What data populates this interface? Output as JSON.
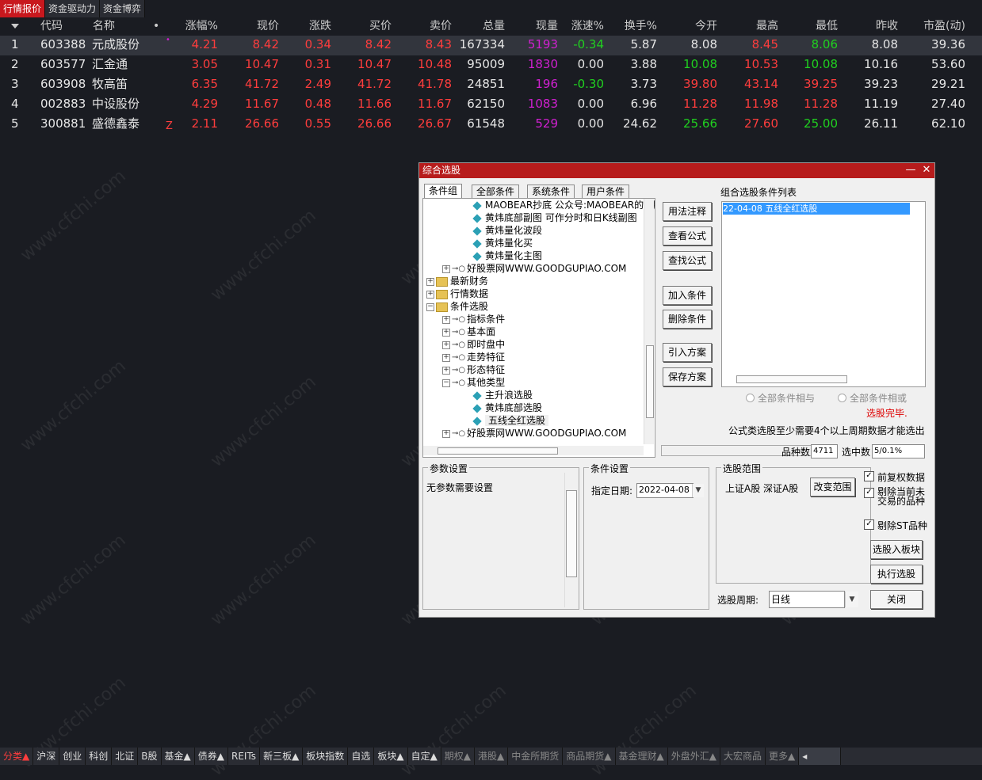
{
  "top_tabs": [
    "行情报价",
    "资金驱动力",
    "资金博弈"
  ],
  "columns": [
    "代码",
    "名称",
    "•",
    "涨幅%",
    "现价",
    "涨跌",
    "买价",
    "卖价",
    "总量",
    "现量",
    "涨速%",
    "换手%",
    "今开",
    "最高",
    "最低",
    "昨收",
    "市盈(动)"
  ],
  "rows": [
    {
      "idx": "1",
      "code": "603388",
      "name": "元成股份",
      "flag": "•",
      "chg_pct": "4.21",
      "price": "8.42",
      "chg": "0.34",
      "bid": "8.42",
      "ask": "8.43",
      "vol": "167334",
      "cur_vol": "5193",
      "speed": "-0.34",
      "turnover": "5.87",
      "open": "8.08",
      "high": "8.45",
      "low": "8.06",
      "prev": "8.08",
      "pe": "39.36"
    },
    {
      "idx": "2",
      "code": "603577",
      "name": "汇金通",
      "flag": "",
      "chg_pct": "3.05",
      "price": "10.47",
      "chg": "0.31",
      "bid": "10.47",
      "ask": "10.48",
      "vol": "95009",
      "cur_vol": "1830",
      "speed": "0.00",
      "turnover": "3.88",
      "open": "10.08",
      "high": "10.53",
      "low": "10.08",
      "prev": "10.16",
      "pe": "53.60"
    },
    {
      "idx": "3",
      "code": "603908",
      "name": "牧高笛",
      "flag": "",
      "chg_pct": "6.35",
      "price": "41.72",
      "chg": "2.49",
      "bid": "41.72",
      "ask": "41.78",
      "vol": "24851",
      "cur_vol": "196",
      "speed": "-0.30",
      "turnover": "3.73",
      "open": "39.80",
      "high": "43.14",
      "low": "39.25",
      "prev": "39.23",
      "pe": "29.21"
    },
    {
      "idx": "4",
      "code": "002883",
      "name": "中设股份",
      "flag": "",
      "chg_pct": "4.29",
      "price": "11.67",
      "chg": "0.48",
      "bid": "11.66",
      "ask": "11.67",
      "vol": "62150",
      "cur_vol": "1083",
      "speed": "0.00",
      "turnover": "6.96",
      "open": "11.28",
      "high": "11.98",
      "low": "11.28",
      "prev": "11.19",
      "pe": "27.40"
    },
    {
      "idx": "5",
      "code": "300881",
      "name": "盛德鑫泰",
      "flag": "Z",
      "chg_pct": "2.11",
      "price": "26.66",
      "chg": "0.55",
      "bid": "26.66",
      "ask": "26.67",
      "vol": "61548",
      "cur_vol": "529",
      "speed": "0.00",
      "turnover": "24.62",
      "open": "25.66",
      "high": "27.60",
      "low": "25.00",
      "prev": "26.11",
      "pe": "62.10"
    }
  ],
  "dialog": {
    "title": "综合选股",
    "tabs": [
      "条件组",
      "全部条件",
      "系统条件",
      "用户条件"
    ],
    "tree": [
      {
        "label": "MAOBEAR抄底 公众号:MAOBEAR的小脑门",
        "type": "gem"
      },
      {
        "label": "黄炜底部副图 可作分时和日K线副图",
        "type": "gem"
      },
      {
        "label": "黄炜量化波段",
        "type": "gem"
      },
      {
        "label": "黄炜量化买",
        "type": "gem"
      },
      {
        "label": "黄炜量化主图",
        "type": "gem"
      },
      {
        "label": "好股票网WWW.GOODGUPIAO.COM",
        "type": "key"
      },
      {
        "label": "最新财务",
        "type": "folder"
      },
      {
        "label": "行情数据",
        "type": "folder"
      },
      {
        "label": "条件选股",
        "type": "folder"
      },
      {
        "label": "指标条件",
        "type": "key"
      },
      {
        "label": "基本面",
        "type": "key"
      },
      {
        "label": "即时盘中",
        "type": "key"
      },
      {
        "label": "走势特征",
        "type": "key"
      },
      {
        "label": "形态特征",
        "type": "key"
      },
      {
        "label": "其他类型",
        "type": "key"
      },
      {
        "label": "主升浪选股",
        "type": "gem"
      },
      {
        "label": "黄炜底部选股",
        "type": "gem"
      },
      {
        "label": "五线全红选股",
        "type": "gem"
      },
      {
        "label": "好股票网WWW.GOODGUPIAO.COM",
        "type": "key"
      }
    ],
    "buttons_mid": [
      "用法注释",
      "查看公式",
      "查找公式",
      "加入条件",
      "删除条件",
      "引入方案",
      "保存方案"
    ],
    "list_title": "组合选股条件列表",
    "list_item": "22-04-08 五线全红选股",
    "radio_and": "全部条件相与",
    "radio_or": "全部条件相或",
    "status": "选股完毕.",
    "note": "公式类选股至少需要4个以上周期数据才能选出",
    "count_label": "品种数",
    "count_value": "4711",
    "hit_label": "选中数",
    "hit_value": "5/0.1%",
    "param_title": "参数设置",
    "param_text": "无参数需要设置",
    "cond_title": "条件设置",
    "date_label": "指定日期:",
    "date_value": "2022-04-08",
    "range_title": "选股范围",
    "range_text": "上证A股  深证A股",
    "change_range": "改变范围",
    "chk_adjust": "前复权数据",
    "chk_excl_trading_1": "剔除当前未",
    "chk_excl_trading_2": "交易的品种",
    "chk_excl_st": "剔除ST品种",
    "btn_to_block": "选股入板块",
    "btn_execute": "执行选股",
    "btn_close": "关闭",
    "period_label": "选股周期:",
    "period_value": "日线"
  },
  "bottom_tabs": [
    "分类▲",
    "沪深",
    "创业",
    "科创",
    "北证",
    "B股",
    "基金▲",
    "债券▲",
    "REITs",
    "新三板▲",
    "板块指数",
    "自选",
    "板块▲",
    "自定▲",
    "期权▲",
    "港股▲",
    "中金所期货",
    "商品期货▲",
    "基金理财▲",
    "外盘外汇▲",
    "大宏商品",
    "更多▲"
  ],
  "watermark": "www.cfchi.com"
}
